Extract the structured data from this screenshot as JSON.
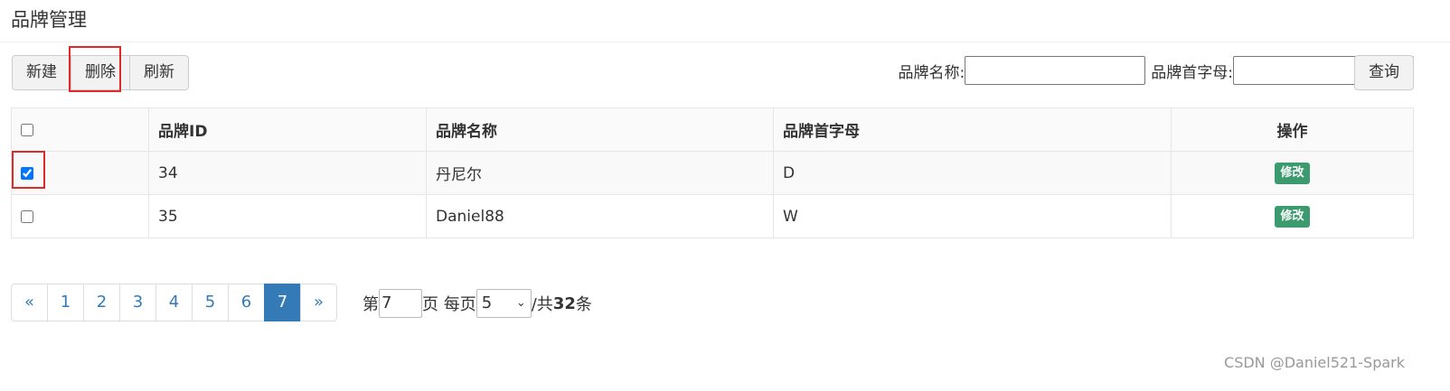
{
  "page": {
    "title": "品牌管理"
  },
  "toolbar": {
    "new_label": "新建",
    "delete_label": "删除",
    "refresh_label": "刷新"
  },
  "search": {
    "name_label": "品牌名称:",
    "name_value": "",
    "initial_label": "品牌首字母:",
    "initial_value": "",
    "query_label": "查询"
  },
  "table": {
    "headers": {
      "id": "品牌ID",
      "name": "品牌名称",
      "initial": "品牌首字母",
      "ops": "操作"
    },
    "rows": [
      {
        "checked": true,
        "id": "34",
        "name": "丹尼尔",
        "initial": "D",
        "action": "修改"
      },
      {
        "checked": false,
        "id": "35",
        "name": "Daniel88",
        "initial": "W",
        "action": "修改"
      }
    ]
  },
  "pagination": {
    "prev": "«",
    "next": "»",
    "pages": [
      "1",
      "2",
      "3",
      "4",
      "5",
      "6",
      "7"
    ],
    "active_page": "7"
  },
  "pager_info": {
    "prefix": "第",
    "page_value": "7",
    "page_suffix": "页 每页",
    "page_size": "5",
    "total_prefix": "/共",
    "total": "32",
    "total_suffix": "条"
  },
  "watermark": "CSDN @Daniel521-Spark",
  "colors": {
    "primary": "#337ab7",
    "success": "#3c9a6f",
    "highlight": "#e02a2a"
  }
}
